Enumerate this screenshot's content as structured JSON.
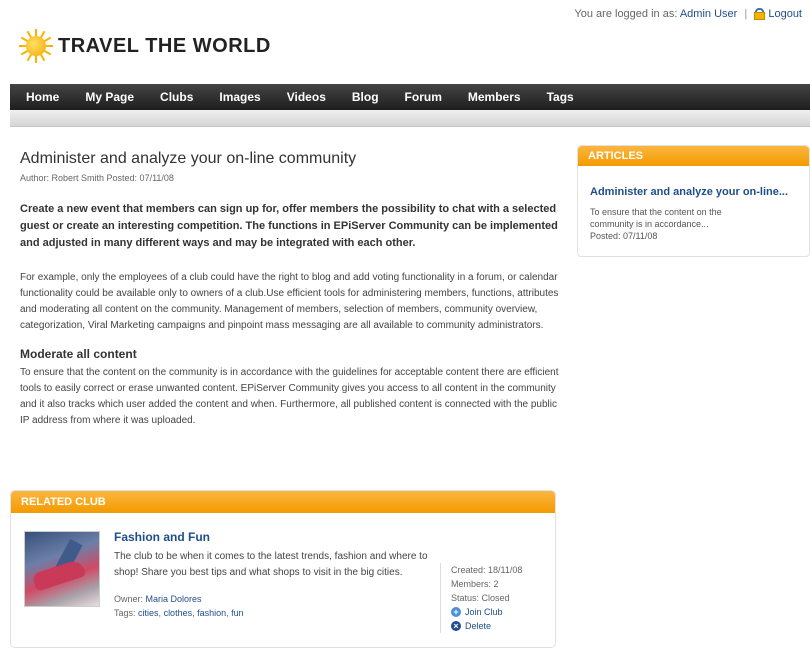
{
  "header": {
    "logged_in_prefix": "You are logged in as:",
    "user_name": "Admin User",
    "separator": "|",
    "logout": "Logout",
    "logo_text": "TRAVEL THE WORLD"
  },
  "nav": {
    "items": [
      "Home",
      "My Page",
      "Clubs",
      "Images",
      "Videos",
      "Blog",
      "Forum",
      "Members",
      "Tags"
    ]
  },
  "article": {
    "title": "Administer and analyze your on-line community",
    "meta": "Author: Robert Smith   Posted: 07/11/08",
    "lead": "Create a new event that members can sign up for, offer members the possibility to chat with a selected guest or create an interesting competition. The functions in EPiServer Community can be implemented and adjusted in many different ways and may be integrated with each other.",
    "body": "For example, only the employees of a club could have the right to blog and add voting functionality in a forum, or calendar functionality could be available only to owners of a club.Use efficient tools for administering members, functions, attributes and moderating all content on the community. Management of members, selection of members, community overview, categorization, Viral Marketing campaigns and pinpoint mass messaging are all available to community administrators.",
    "section_heading": "Moderate all content",
    "section_body": "To ensure that the content on the community is in accordance with the guidelines for acceptable content there are efficient tools to easily correct or erase unwanted content. EPiServer Community gives you access to all content in the community and it also tracks which user added the content and when. Furthermore, all published content is connected with the public IP address from where it was uploaded."
  },
  "articles_box": {
    "heading": "ARTICLES",
    "item_title": "Administer and analyze your on-line...",
    "item_desc": "To ensure that the content on the community is in accordance...",
    "item_date": "Posted: 07/11/08"
  },
  "related_club": {
    "heading": "RELATED CLUB",
    "name": "Fashion and Fun",
    "description": "The club to be when it comes to the latest trends, fashion and where to shop! Share you best tips and what shops to visit in the big cities.",
    "owner_label": "Owner:",
    "owner": "Maria Dolores",
    "tags_label": "Tags:",
    "tags": [
      "cities",
      "clothes",
      "fashion",
      "fun"
    ],
    "created": "Created: 18/11/08",
    "members": "Members: 2",
    "status": "Status: Closed",
    "join": "Join Club",
    "delete": "Delete"
  },
  "colors": {
    "accent_orange": "#f39a00",
    "link_blue": "#1f4e8c",
    "nav_dark": "#1e1e1e"
  },
  "icons": [
    "sun-logo-icon",
    "lock-icon",
    "plus-circle-icon",
    "x-circle-icon"
  ]
}
